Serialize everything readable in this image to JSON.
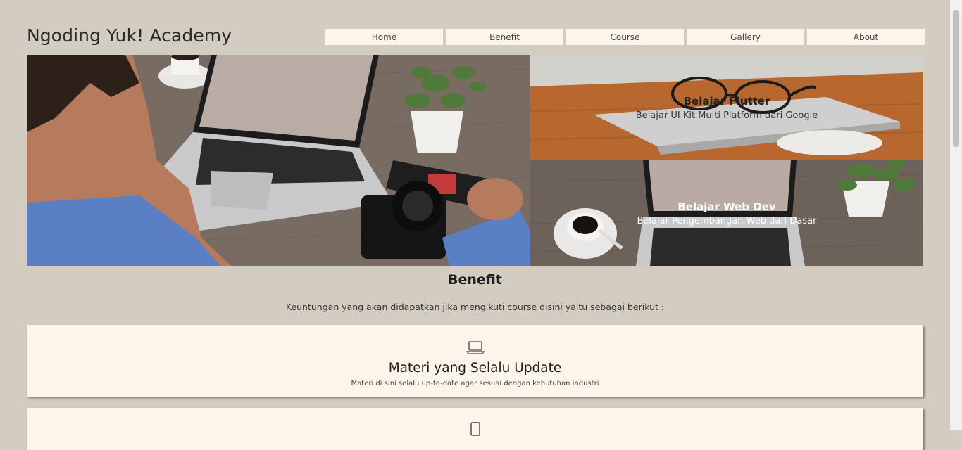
{
  "header": {
    "brand": "Ngoding Yuk! Academy",
    "nav": [
      "Home",
      "Benefit",
      "Course",
      "Gallery",
      "About"
    ]
  },
  "hero": {
    "cards": [
      {
        "title": "Belajar Flutter",
        "subtitle": "Belajar UI Kit Multi Platform dari Google"
      },
      {
        "title": "Belajar Web Dev",
        "subtitle": "Belajar Pengembangan Web dari Dasar"
      }
    ]
  },
  "benefit": {
    "title": "Benefit",
    "description": "Keuntungan yang akan didapatkan jika mengikuti course disini yaitu sebagai berikut :",
    "items": [
      {
        "icon": "laptop-icon",
        "title": "Materi yang Selalu Update",
        "description": "Materi di sini selalu up-to-date agar sesuai dengan kebutuhan industri"
      },
      {
        "icon": "mobile-icon",
        "title": "",
        "description": ""
      }
    ]
  },
  "colors": {
    "background": "#d3ccc0",
    "card": "#fdf5ea"
  }
}
